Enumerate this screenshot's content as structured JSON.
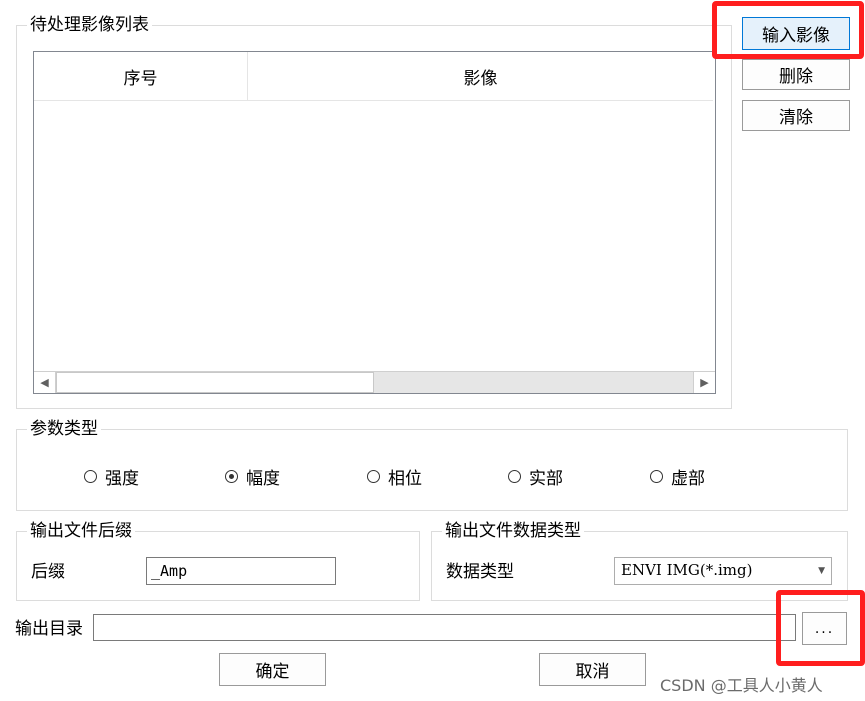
{
  "list_group": {
    "title": "待处理影像列表",
    "columns": [
      "序号",
      "影像"
    ],
    "rows": []
  },
  "side_buttons": {
    "input_image": "输入影像",
    "delete": "删除",
    "clear": "清除"
  },
  "param_group": {
    "title": "参数类型",
    "options": [
      "强度",
      "幅度",
      "相位",
      "实部",
      "虚部"
    ],
    "selected": "幅度"
  },
  "suffix_group": {
    "title": "输出文件后缀",
    "label": "后缀",
    "value": "_Amp"
  },
  "datatype_group": {
    "title": "输出文件数据类型",
    "label": "数据类型",
    "selected": "ENVI IMG(*.img)"
  },
  "output_dir": {
    "label": "输出目录",
    "value": "",
    "browse_label": "..."
  },
  "footer": {
    "ok": "确定",
    "cancel": "取消"
  },
  "watermark": "CSDN @工具人小黄人",
  "colors": {
    "highlight": "#ff1e1e",
    "focus_border": "#0078d7"
  }
}
